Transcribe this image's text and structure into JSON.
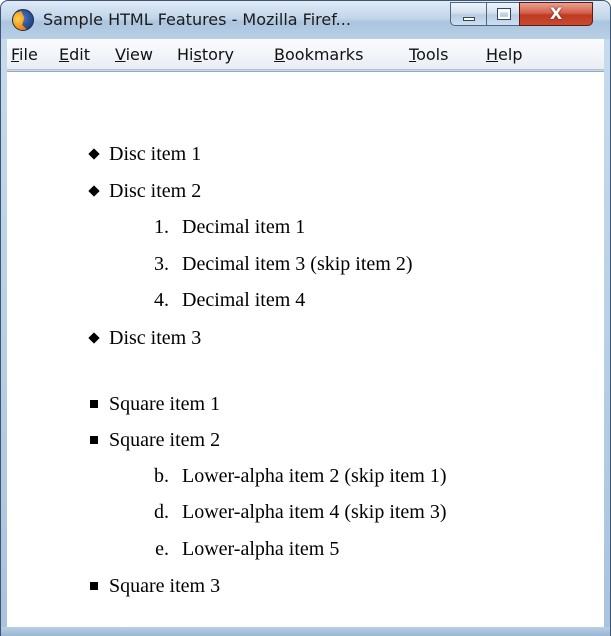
{
  "window": {
    "title": "Sample HTML Features - Mozilla Firef...",
    "buttons": {
      "minimize": "minimize",
      "maximize": "maximize",
      "close": "X"
    }
  },
  "menubar": {
    "items": [
      {
        "label": "File",
        "accel": "F",
        "rest": "ile"
      },
      {
        "label": "Edit",
        "accel": "E",
        "rest": "dit"
      },
      {
        "label": "View",
        "accel": "V",
        "rest": "iew"
      },
      {
        "label": "History",
        "pre": "Hi",
        "accel": "s",
        "rest": "tory"
      },
      {
        "label": "Bookmarks",
        "accel": "B",
        "rest": "ookmarks"
      },
      {
        "label": "Tools",
        "accel": "T",
        "rest": "ools"
      },
      {
        "label": "Help",
        "accel": "H",
        "rest": "elp"
      }
    ]
  },
  "content": {
    "disc_list": {
      "items": [
        "Disc item 1",
        "Disc item 2",
        "Disc item 3"
      ]
    },
    "decimal_list": {
      "items": [
        {
          "marker": "1.",
          "text": "Decimal item 1"
        },
        {
          "marker": "3.",
          "text": "Decimal item 3 (skip item 2)"
        },
        {
          "marker": "4.",
          "text": "Decimal item 4"
        }
      ]
    },
    "square_list": {
      "items": [
        "Square item 1",
        "Square item 2",
        "Square item 3"
      ]
    },
    "alpha_list": {
      "items": [
        {
          "marker": "b.",
          "text": "Lower-alpha item 2 (skip item 1)"
        },
        {
          "marker": "d.",
          "text": "Lower-alpha item 4 (skip item 3)"
        },
        {
          "marker": "e.",
          "text": "Lower-alpha item 5"
        }
      ]
    }
  },
  "colors": {
    "title_bar": "#c2d6ea",
    "close_button": "#c84a30",
    "content_bg": "#ffffff",
    "text": "#000000"
  },
  "icons": {
    "app": "firefox-icon",
    "disc_marker": "disc-bullet-icon",
    "square_marker": "square-bullet-icon"
  }
}
